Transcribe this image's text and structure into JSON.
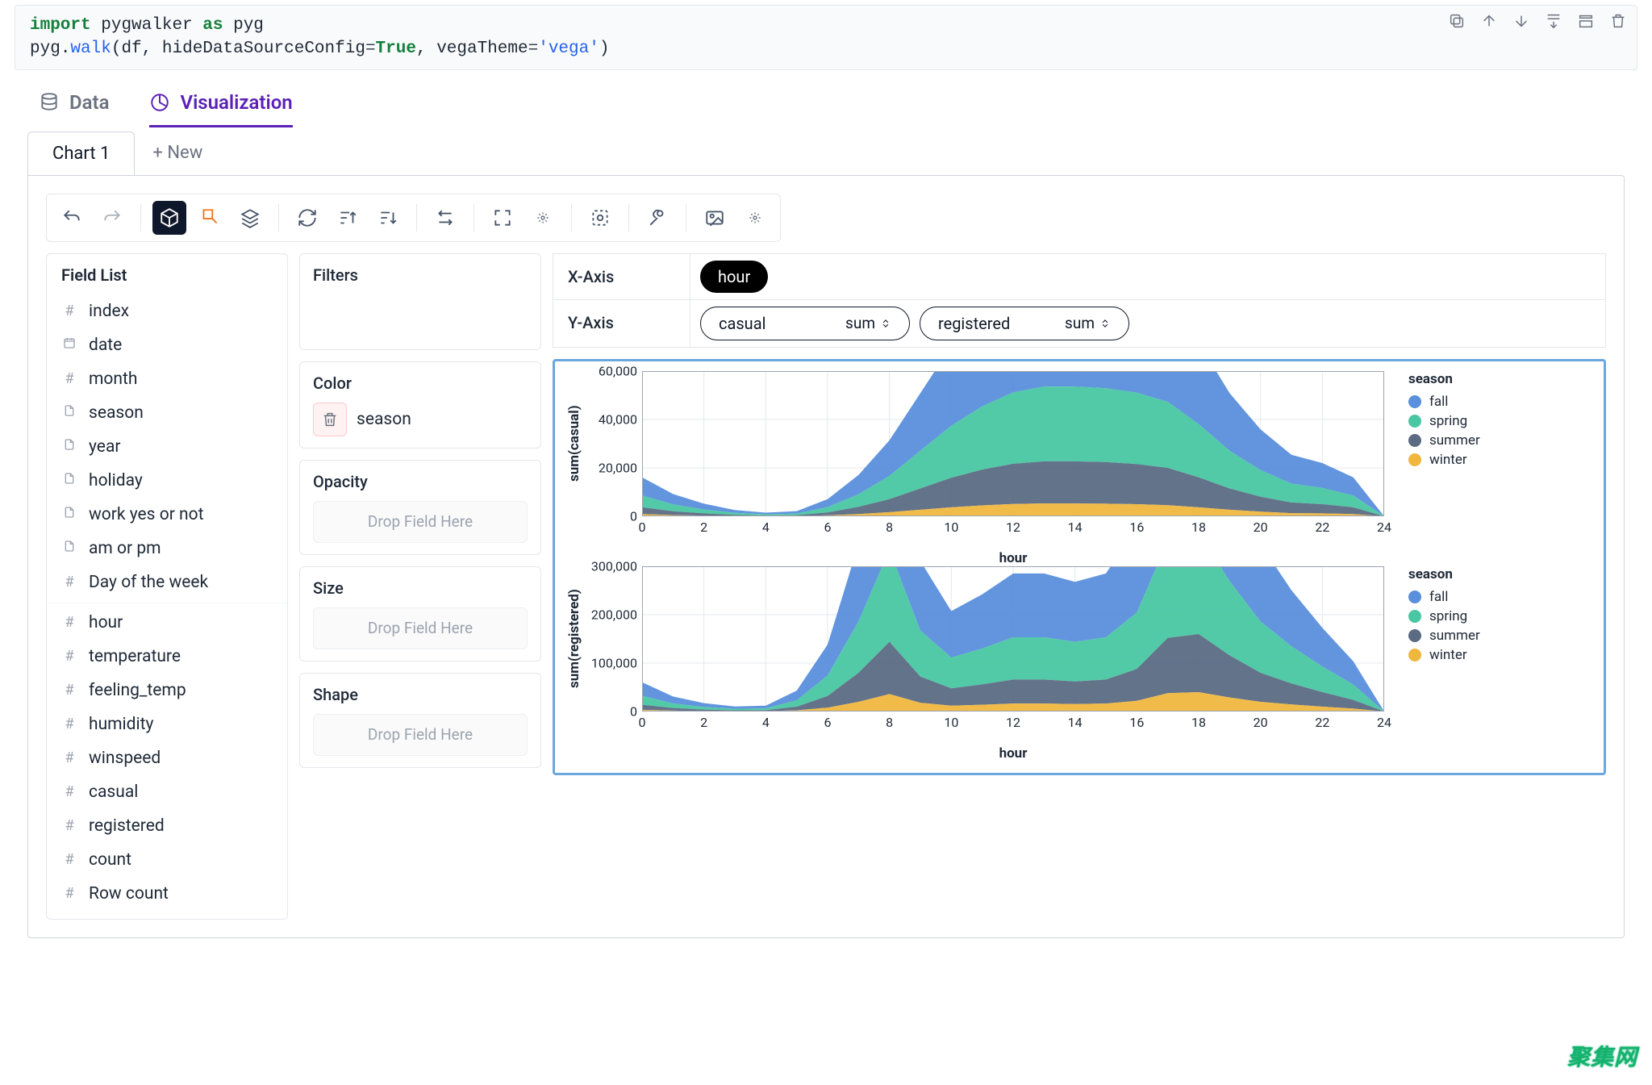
{
  "code_cell": {
    "line1": {
      "import": "import",
      "mod": "pygwalker",
      "as": "as",
      "alias": "pyg"
    },
    "line2": {
      "obj": "pyg",
      "dot": ".",
      "fn": "walk",
      "open": "(",
      "df": "df",
      "c1": ", ",
      "arg1": "hideDataSourceConfig",
      "eq": "=",
      "true": "True",
      "c2": ", ",
      "arg2": "vegaTheme",
      "eq2": "=",
      "str": "'vega'",
      "close": ")"
    }
  },
  "cell_toolbar": [
    "copy",
    "move-up",
    "move-down",
    "insert-below",
    "expand",
    "delete"
  ],
  "top_tabs": {
    "data": "Data",
    "viz": "Visualization"
  },
  "chart_tabs": {
    "tab1": "Chart 1",
    "new": "+ New"
  },
  "sections": {
    "fieldlist_title": "Field List",
    "filters": "Filters",
    "color": "Color",
    "opacity": "Opacity",
    "size": "Size",
    "shape": "Shape",
    "dropzone": "Drop Field Here",
    "xaxis": "X-Axis",
    "yaxis": "Y-Axis"
  },
  "color_field": "season",
  "fields": [
    {
      "icon": "#",
      "name": "index"
    },
    {
      "icon": "cal",
      "name": "date"
    },
    {
      "icon": "#",
      "name": "month"
    },
    {
      "icon": "doc",
      "name": "season"
    },
    {
      "icon": "doc",
      "name": "year"
    },
    {
      "icon": "doc",
      "name": "holiday"
    },
    {
      "icon": "doc",
      "name": "work yes or not"
    },
    {
      "icon": "doc",
      "name": "am or pm"
    },
    {
      "icon": "#",
      "name": "Day of the week"
    },
    {
      "icon": "#",
      "name": "hour",
      "sep": true
    },
    {
      "icon": "#",
      "name": "temperature"
    },
    {
      "icon": "#",
      "name": "feeling_temp"
    },
    {
      "icon": "#",
      "name": "humidity"
    },
    {
      "icon": "#",
      "name": "winspeed"
    },
    {
      "icon": "#",
      "name": "casual"
    },
    {
      "icon": "#",
      "name": "registered"
    },
    {
      "icon": "#",
      "name": "count"
    },
    {
      "icon": "#",
      "name": "Row count"
    }
  ],
  "x_chips": [
    {
      "label": "hour",
      "style": "black"
    }
  ],
  "y_chips": [
    {
      "label": "casual",
      "agg": "sum",
      "style": "outline"
    },
    {
      "label": "registered",
      "agg": "sum",
      "style": "outline"
    }
  ],
  "legend_title": "season",
  "legend_items": [
    {
      "label": "fall",
      "color": "#5a8fdc"
    },
    {
      "label": "spring",
      "color": "#49c7a2"
    },
    {
      "label": "summer",
      "color": "#5b6b84"
    },
    {
      "label": "winter",
      "color": "#f0b73f"
    }
  ],
  "chart_data": [
    {
      "type": "area",
      "xlabel": "hour",
      "ylabel": "sum(casual)",
      "x": [
        0,
        1,
        2,
        3,
        4,
        5,
        6,
        7,
        8,
        9,
        10,
        11,
        12,
        13,
        14,
        15,
        16,
        17,
        18,
        19,
        20,
        21,
        22,
        23,
        24
      ],
      "x_ticks": [
        0,
        2,
        4,
        6,
        8,
        10,
        12,
        14,
        16,
        18,
        20,
        22,
        24
      ],
      "ylim": [
        0,
        60000
      ],
      "y_ticks": [
        0,
        20000,
        40000,
        60000
      ],
      "y_tick_labels": [
        "0",
        "20,000",
        "40,000",
        "60,000"
      ],
      "stack_order": [
        "winter",
        "summer",
        "spring",
        "fall"
      ],
      "series": {
        "winter": [
          900,
          500,
          300,
          150,
          80,
          120,
          400,
          900,
          1700,
          2700,
          3700,
          4500,
          5100,
          5300,
          5300,
          5200,
          5000,
          4600,
          3700,
          2700,
          1900,
          1300,
          1200,
          900,
          0
        ],
        "summer": [
          2800,
          1600,
          900,
          450,
          250,
          350,
          1200,
          3000,
          5400,
          8800,
          12200,
          14800,
          16600,
          17400,
          17400,
          17200,
          16600,
          15400,
          12400,
          8800,
          6200,
          4400,
          3800,
          2800,
          0
        ],
        "spring": [
          4900,
          2800,
          1600,
          800,
          450,
          650,
          2200,
          5200,
          9600,
          15600,
          21500,
          26100,
          29500,
          30900,
          30900,
          30500,
          29500,
          27300,
          22000,
          15600,
          11000,
          7800,
          6700,
          4900,
          0
        ],
        "fall": [
          7500,
          4300,
          2400,
          1200,
          700,
          1000,
          3300,
          8000,
          14700,
          23800,
          33000,
          40000,
          45200,
          47300,
          47300,
          46700,
          45200,
          41800,
          33700,
          23800,
          16800,
          11900,
          10300,
          7500,
          0
        ]
      }
    },
    {
      "type": "area",
      "xlabel": "hour",
      "ylabel": "sum(registered)",
      "x": [
        0,
        1,
        2,
        3,
        4,
        5,
        6,
        7,
        8,
        9,
        10,
        11,
        12,
        13,
        14,
        15,
        16,
        17,
        18,
        19,
        20,
        21,
        22,
        23,
        24
      ],
      "x_ticks": [
        0,
        2,
        4,
        6,
        8,
        10,
        12,
        14,
        16,
        18,
        20,
        22,
        24
      ],
      "ylim": [
        0,
        300000
      ],
      "y_ticks": [
        0,
        100000,
        200000,
        300000
      ],
      "y_tick_labels": [
        "0",
        "100,000",
        "200,000",
        "300,000"
      ],
      "stack_order": [
        "winter",
        "summer",
        "spring",
        "fall"
      ],
      "series": {
        "winter": [
          3500,
          1800,
          1000,
          600,
          700,
          2500,
          8000,
          20000,
          36000,
          18000,
          12000,
          14000,
          16500,
          16500,
          15500,
          16500,
          22000,
          38000,
          40000,
          29000,
          20000,
          14500,
          10000,
          6000,
          0
        ],
        "summer": [
          10500,
          5400,
          3000,
          1800,
          2100,
          7500,
          24000,
          60000,
          108000,
          54000,
          36000,
          42000,
          49500,
          49500,
          46500,
          49500,
          66000,
          114000,
          120000,
          87000,
          60000,
          43500,
          30000,
          18000,
          0
        ],
        "spring": [
          18500,
          9500,
          5300,
          3200,
          3700,
          13200,
          42400,
          106000,
          190000,
          95000,
          63500,
          74000,
          87300,
          87300,
          82000,
          87300,
          116300,
          201000,
          211500,
          153300,
          105800,
          76700,
          52900,
          31700,
          0
        ],
        "fall": [
          28000,
          14400,
          8000,
          4800,
          5600,
          20000,
          64000,
          160000,
          288000,
          144000,
          96000,
          112000,
          132000,
          132000,
          124000,
          132000,
          176000,
          284000,
          292000,
          232000,
          160000,
          116000,
          80000,
          48000,
          0
        ]
      }
    }
  ],
  "watermark": "聚集网"
}
